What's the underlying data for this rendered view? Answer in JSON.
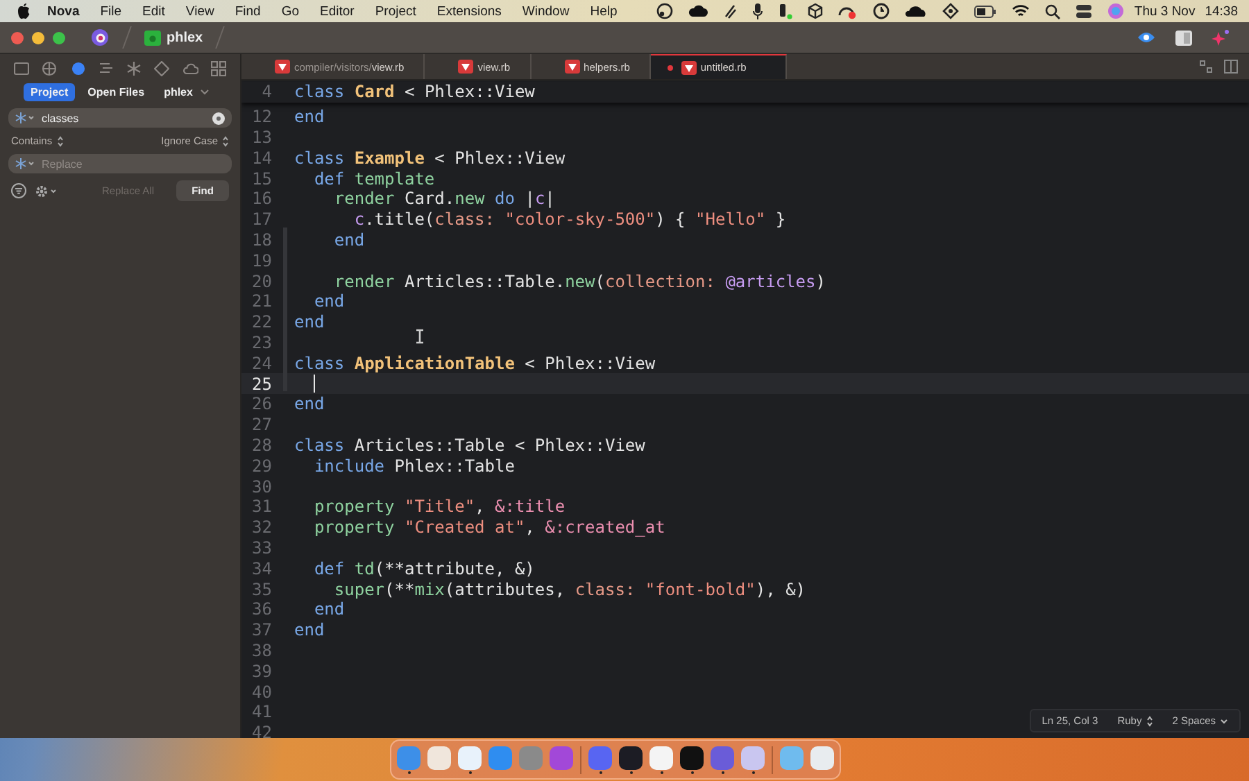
{
  "menu_bar": {
    "app": "Nova",
    "items": [
      "File",
      "Edit",
      "View",
      "Find",
      "Go",
      "Editor",
      "Project",
      "Extensions",
      "Window",
      "Help"
    ],
    "date": "Thu 3 Nov",
    "time": "14:38"
  },
  "window": {
    "project": "phlex"
  },
  "sidebar": {
    "tabs": [
      {
        "kind": "folder",
        "selected": false
      },
      {
        "kind": "globe",
        "selected": false
      },
      {
        "kind": "search",
        "selected": true
      },
      {
        "kind": "list",
        "selected": false
      },
      {
        "kind": "asterisk",
        "selected": false
      },
      {
        "kind": "diamond",
        "selected": false
      },
      {
        "kind": "cloud",
        "selected": false
      },
      {
        "kind": "grid",
        "selected": false
      }
    ],
    "scopes": [
      {
        "label": "Project",
        "selected": true,
        "has_menu": false
      },
      {
        "label": "Open Files",
        "selected": false,
        "has_menu": false
      },
      {
        "label": "phlex",
        "selected": false,
        "has_menu": true
      }
    ],
    "search": {
      "value": "classes"
    },
    "match_mode": "Contains",
    "case_mode": "Ignore Case",
    "replace": {
      "placeholder": "Replace"
    },
    "buttons": [
      {
        "label": "Replace All",
        "disabled": true
      },
      {
        "label": "Find",
        "disabled": false
      }
    ]
  },
  "tabs": [
    {
      "path": "compiler/visitors/",
      "name": "view.rb",
      "selected": false,
      "modified": false
    },
    {
      "name": "view.rb",
      "selected": false,
      "modified": false
    },
    {
      "name": "helpers.rb",
      "selected": false,
      "modified": false
    },
    {
      "name": "untitled.rb",
      "selected": true,
      "modified": true
    }
  ],
  "sticky_line": {
    "number": "4",
    "tokens": [
      {
        "kind": "kw",
        "text": "class "
      },
      {
        "kind": "type",
        "text": "Card"
      },
      {
        "kind": "plain",
        "text": " < Phlex::View"
      }
    ]
  },
  "lines": [
    {
      "number": "12",
      "current": false,
      "tokens": [
        {
          "kind": "kw",
          "text": "end"
        }
      ]
    },
    {
      "number": "13",
      "current": false
    },
    {
      "number": "14",
      "current": false,
      "tokens": [
        {
          "kind": "kw",
          "text": "class "
        },
        {
          "kind": "type",
          "text": "Example"
        },
        {
          "kind": "plain",
          "text": " < Phlex::View"
        }
      ]
    },
    {
      "number": "15",
      "current": false,
      "tokens": [
        {
          "kind": "kw",
          "text": "  def "
        },
        {
          "kind": "fn",
          "text": "template"
        }
      ]
    },
    {
      "number": "16",
      "current": false,
      "tokens": [
        {
          "kind": "fn",
          "text": "    render"
        },
        {
          "kind": "plain",
          "text": " Card."
        },
        {
          "kind": "fn",
          "text": "new"
        },
        {
          "kind": "kw",
          "text": " do"
        },
        {
          "kind": "plain",
          "text": " |"
        },
        {
          "kind": "var",
          "text": "c"
        },
        {
          "kind": "plain",
          "text": "|"
        }
      ]
    },
    {
      "number": "17",
      "current": false,
      "tokens": [
        {
          "kind": "var",
          "text": "      c"
        },
        {
          "kind": "plain",
          "text": ".title("
        },
        {
          "kind": "label",
          "text": "class:"
        },
        {
          "kind": "str",
          "text": " \"color-sky-500\""
        },
        {
          "kind": "plain",
          "text": ") { "
        },
        {
          "kind": "str",
          "text": "\"Hello\""
        },
        {
          "kind": "plain",
          "text": " }"
        }
      ]
    },
    {
      "number": "18",
      "current": false,
      "tokens": [
        {
          "kind": "kw",
          "text": "    end"
        }
      ]
    },
    {
      "number": "19",
      "current": false
    },
    {
      "number": "20",
      "current": false,
      "tokens": [
        {
          "kind": "fn",
          "text": "    render"
        },
        {
          "kind": "plain",
          "text": " Articles::Table."
        },
        {
          "kind": "fn",
          "text": "new"
        },
        {
          "kind": "plain",
          "text": "("
        },
        {
          "kind": "label",
          "text": "collection:"
        },
        {
          "kind": "var",
          "text": " @articles"
        },
        {
          "kind": "plain",
          "text": ")"
        }
      ]
    },
    {
      "number": "21",
      "current": false,
      "tokens": [
        {
          "kind": "kw",
          "text": "  end"
        }
      ]
    },
    {
      "number": "22",
      "current": false,
      "tokens": [
        {
          "kind": "kw",
          "text": "end"
        }
      ]
    },
    {
      "number": "23",
      "current": false
    },
    {
      "number": "24",
      "current": false,
      "tokens": [
        {
          "kind": "kw",
          "text": "class "
        },
        {
          "kind": "type",
          "text": "ApplicationTable"
        },
        {
          "kind": "plain",
          "text": " < Phlex::View"
        }
      ]
    },
    {
      "number": "25",
      "current": true
    },
    {
      "number": "26",
      "current": false,
      "tokens": [
        {
          "kind": "kw",
          "text": "end"
        }
      ]
    },
    {
      "number": "27",
      "current": false
    },
    {
      "number": "28",
      "current": false,
      "tokens": [
        {
          "kind": "kw",
          "text": "class"
        },
        {
          "kind": "plain",
          "text": " Articles::Table < Phlex::View"
        }
      ]
    },
    {
      "number": "29",
      "current": false,
      "tokens": [
        {
          "kind": "kw",
          "text": "  include"
        },
        {
          "kind": "plain",
          "text": " Phlex::Table"
        }
      ]
    },
    {
      "number": "30",
      "current": false
    },
    {
      "number": "31",
      "current": false,
      "tokens": [
        {
          "kind": "fn",
          "text": "  property"
        },
        {
          "kind": "str",
          "text": " \"Title\""
        },
        {
          "kind": "plain",
          "text": ", "
        },
        {
          "kind": "sym",
          "text": "&:title"
        }
      ]
    },
    {
      "number": "32",
      "current": false,
      "tokens": [
        {
          "kind": "fn",
          "text": "  property"
        },
        {
          "kind": "str",
          "text": " \"Created at\""
        },
        {
          "kind": "plain",
          "text": ", "
        },
        {
          "kind": "sym",
          "text": "&:created_at"
        }
      ]
    },
    {
      "number": "33",
      "current": false
    },
    {
      "number": "34",
      "current": false,
      "tokens": [
        {
          "kind": "kw",
          "text": "  def "
        },
        {
          "kind": "fn",
          "text": "td"
        },
        {
          "kind": "plain",
          "text": "(**attribute, &)"
        }
      ]
    },
    {
      "number": "35",
      "current": false,
      "tokens": [
        {
          "kind": "fn",
          "text": "    super"
        },
        {
          "kind": "plain",
          "text": "(**"
        },
        {
          "kind": "fn",
          "text": "mix"
        },
        {
          "kind": "plain",
          "text": "(attributes, "
        },
        {
          "kind": "label",
          "text": "class:"
        },
        {
          "kind": "str",
          "text": " \"font-bold\""
        },
        {
          "kind": "plain",
          "text": "), &)"
        }
      ]
    },
    {
      "number": "36",
      "current": false,
      "tokens": [
        {
          "kind": "kw",
          "text": "  end"
        }
      ]
    },
    {
      "number": "37",
      "current": false,
      "tokens": [
        {
          "kind": "kw",
          "text": "end"
        }
      ]
    },
    {
      "number": "38",
      "current": false
    },
    {
      "number": "39",
      "current": false
    },
    {
      "number": "40",
      "current": false
    },
    {
      "number": "41",
      "current": false
    },
    {
      "number": "42",
      "current": false
    }
  ],
  "status_bar": {
    "position": "Ln 25, Col 3",
    "language": "Ruby",
    "indentation": "2 Spaces"
  },
  "dock": {
    "groups": [
      [
        {
          "kind": "finder",
          "running": true
        },
        {
          "kind": "launchpad",
          "running": false
        },
        {
          "kind": "safari",
          "running": true
        },
        {
          "kind": "appstore",
          "running": false
        },
        {
          "kind": "settings",
          "running": false
        },
        {
          "kind": "feedback",
          "running": false
        }
      ],
      [
        {
          "kind": "discord",
          "running": true
        },
        {
          "kind": "obs",
          "running": true
        },
        {
          "kind": "infinity",
          "running": true
        },
        {
          "kind": "terminal",
          "running": true
        },
        {
          "kind": "reader",
          "running": true
        },
        {
          "kind": "nova",
          "running": true
        }
      ],
      [
        {
          "kind": "folder",
          "running": false
        },
        {
          "kind": "trash",
          "running": false
        }
      ]
    ]
  }
}
